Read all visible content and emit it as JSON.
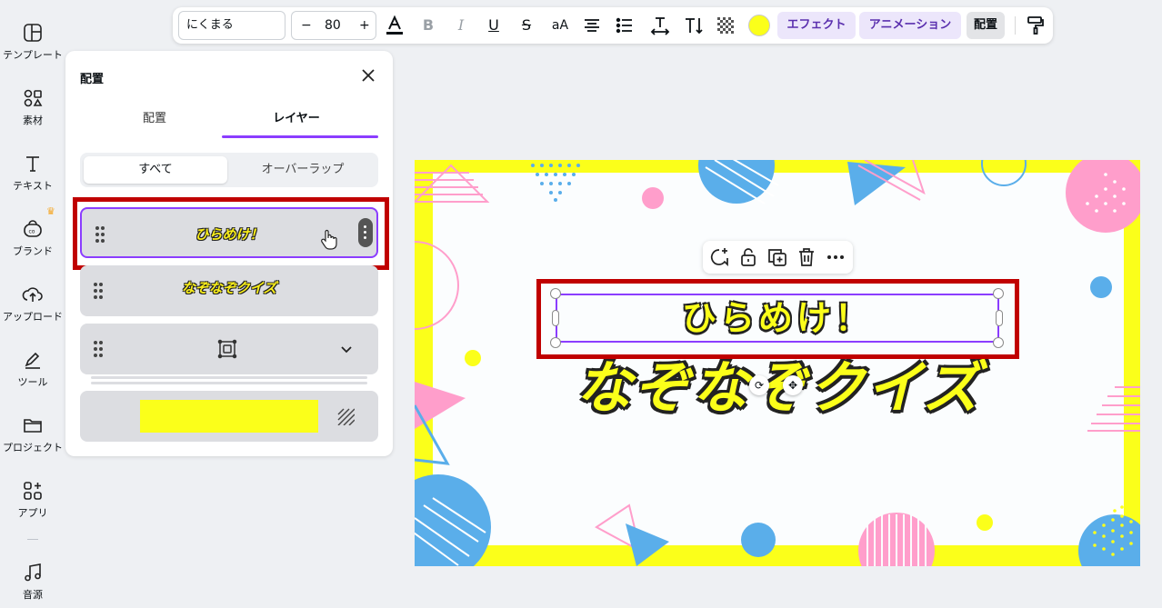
{
  "rail": {
    "items": [
      {
        "label": "テンプレート",
        "icon": "template-icon"
      },
      {
        "label": "素材",
        "icon": "elements-icon"
      },
      {
        "label": "テキスト",
        "icon": "text-icon"
      },
      {
        "label": "ブランド",
        "icon": "brand-icon"
      },
      {
        "label": "アップロード",
        "icon": "upload-icon"
      },
      {
        "label": "ツール",
        "icon": "tools-icon"
      },
      {
        "label": "プロジェクト",
        "icon": "folder-icon"
      },
      {
        "label": "アプリ",
        "icon": "apps-icon"
      },
      {
        "label": "音源",
        "icon": "music-icon"
      }
    ]
  },
  "panel": {
    "title": "配置",
    "tabs": [
      "配置",
      "レイヤー"
    ],
    "active_tab": "レイヤー",
    "segments": [
      "すべて",
      "オーバーラップ"
    ],
    "active_segment": "すべて",
    "layers": [
      {
        "text": "ひらめけ！",
        "selected": true
      },
      {
        "text": "なぞなぞクイズ",
        "selected": false
      },
      {
        "text": "",
        "kind": "group"
      },
      {
        "text": "",
        "kind": "background",
        "color": "#fbff1a"
      }
    ]
  },
  "toolbar": {
    "font": "にくまる",
    "size": "80",
    "minus": "−",
    "plus": "+",
    "text_color": "#fbff1a",
    "effects_label": "エフェクト",
    "animation_label": "アニメーション",
    "position_label": "配置",
    "bold": "B",
    "italic": "I",
    "underline": "U",
    "strike": "S",
    "case": "aA"
  },
  "canvas": {
    "text_top": "ひらめけ！",
    "text_main": "なぞなぞクイズ",
    "accent": "#fbff1a",
    "selection_color": "#8b3dff",
    "annotation_color": "#c00000"
  }
}
